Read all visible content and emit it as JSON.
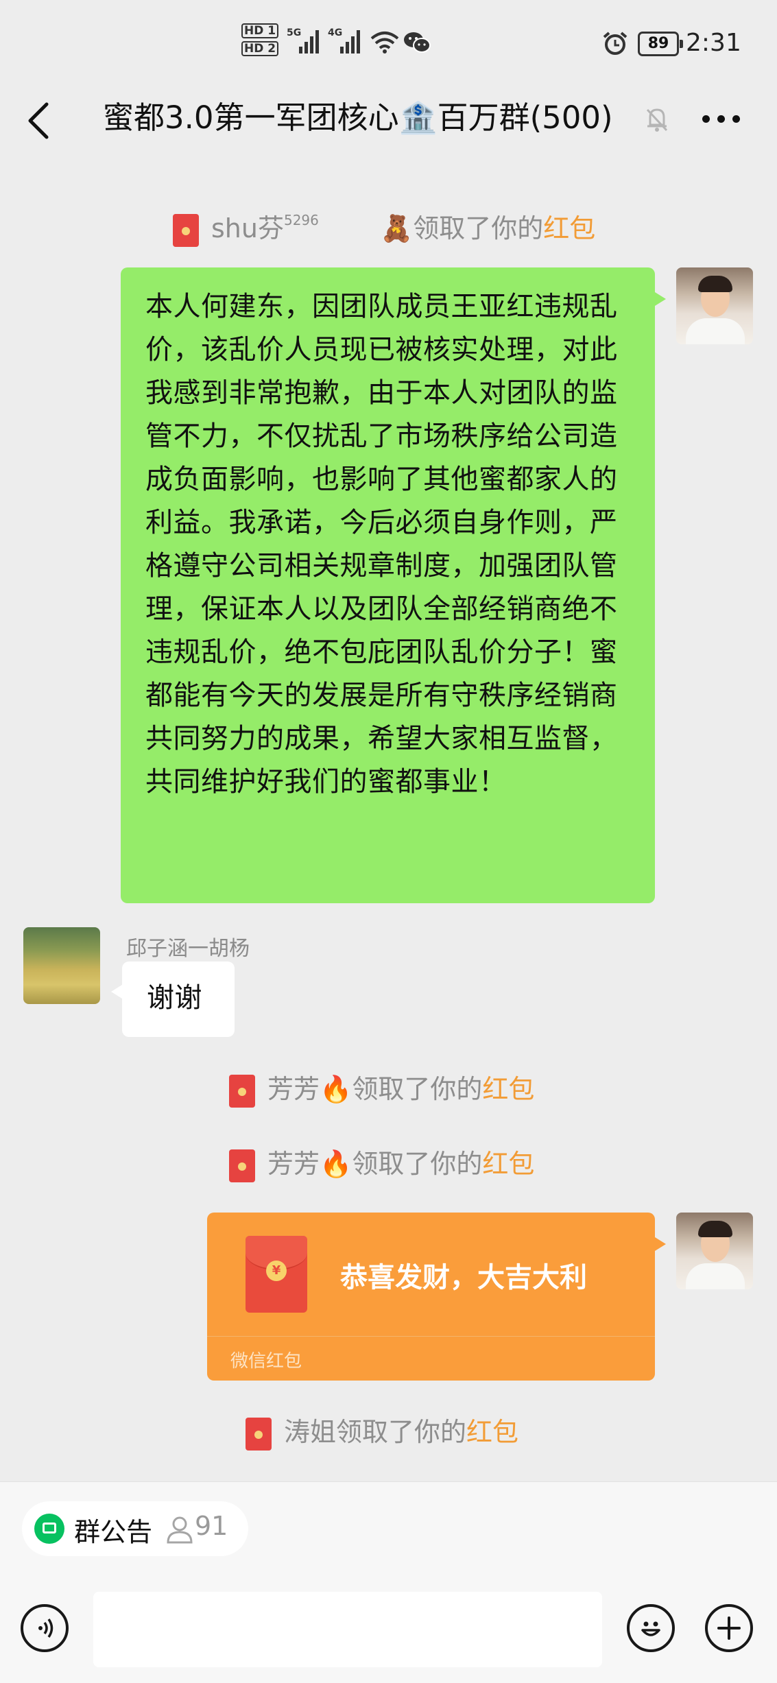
{
  "status_bar": {
    "hd1": "HD 1",
    "hd2": "HD 2",
    "net1": "5G",
    "net2": "4G",
    "battery": "89",
    "time": "2:31"
  },
  "header": {
    "title": "蜜都3.0第一军团核心🏦百万群(500)"
  },
  "messages": {
    "sys1": {
      "name": "shu芬",
      "name_sup": "5296",
      "emoji": "🧸",
      "action": "领取了你的",
      "link": "红包"
    },
    "my_text": "本人何建东，因团队成员王亚红违规乱价，该乱价人员现已被核实处理，对此我感到非常抱歉，由于本人对团队的监管不力，不仅扰乱了市场秩序给公司造成负面影响，也影响了其他蜜都家人的利益。我承诺，今后必须自身作则，严格遵守公司相关规章制度，加强团队管理，保证本人以及团队全部经销商绝不违规乱价，绝不包庇团队乱价分子！蜜都能有今天的发展是所有守秩序经销商共同努力的成果，希望大家相互监督，共同维护好我们的蜜都事业！",
    "other_sender": "邱子涵一胡杨",
    "other_text": "谢谢",
    "sys2": {
      "name": "芳芳",
      "emoji": "🔥",
      "action": "领取了你的",
      "link": "红包"
    },
    "sys3": {
      "name": "芳芳",
      "emoji": "🔥",
      "action": "领取了你的",
      "link": "红包"
    },
    "red_packet": {
      "wish": "恭喜发财，大吉大利",
      "footer": "微信红包",
      "seal": "¥"
    },
    "sys4": {
      "name": "涛姐",
      "action": "领取了你的",
      "link": "红包"
    }
  },
  "bottom": {
    "notice_label": "群公告",
    "member_count": "91"
  }
}
